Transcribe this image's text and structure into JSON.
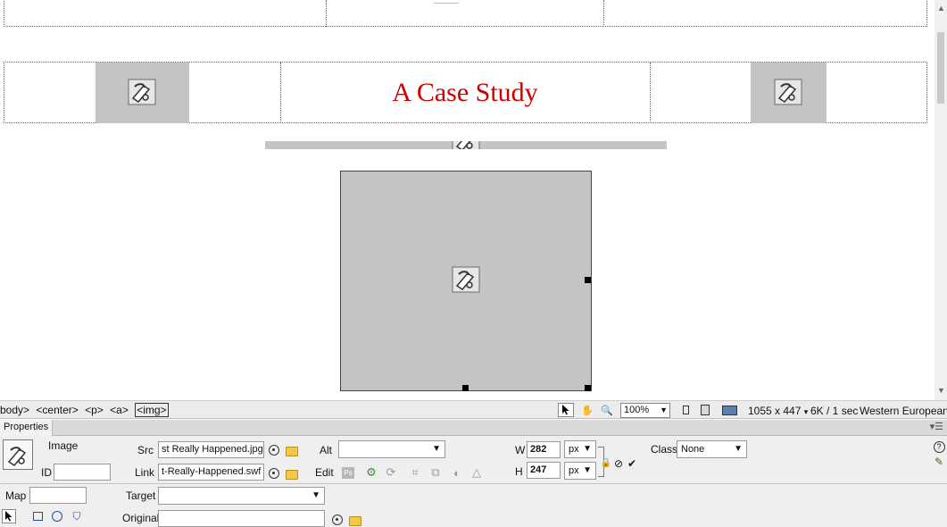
{
  "canvas": {
    "heading": "A Case Study",
    "heading_color": "#cc0000"
  },
  "status_bar": {
    "tags": [
      "<body>",
      "<center>",
      "<p>",
      "<a>",
      "<img>"
    ],
    "selected_tag": "<img>",
    "zoom": "100%",
    "dimensions": "1055 x 447",
    "download": "6K / 1 sec",
    "encoding": "Western European"
  },
  "properties": {
    "panel_title": "Properties",
    "type_label": "Image",
    "id_label": "ID",
    "id_value": "",
    "src_label": "Src",
    "src_value": "st Really Happened.jpg",
    "link_label": "Link",
    "link_value": "t-Really-Happened.swf",
    "alt_label": "Alt",
    "alt_value": "",
    "edit_label": "Edit",
    "w_label": "W",
    "w_value": "282",
    "h_label": "H",
    "h_value": "247",
    "unit_w": "px",
    "unit_h": "px",
    "class_label": "Class",
    "class_value": "None",
    "map_label": "Map",
    "map_value": "",
    "target_label": "Target",
    "target_value": "",
    "original_label": "Original",
    "original_value": ""
  },
  "icons": {
    "placeholder": "image-placeholder-icon",
    "help": "help-icon",
    "edit_props": "edit-properties-icon"
  }
}
